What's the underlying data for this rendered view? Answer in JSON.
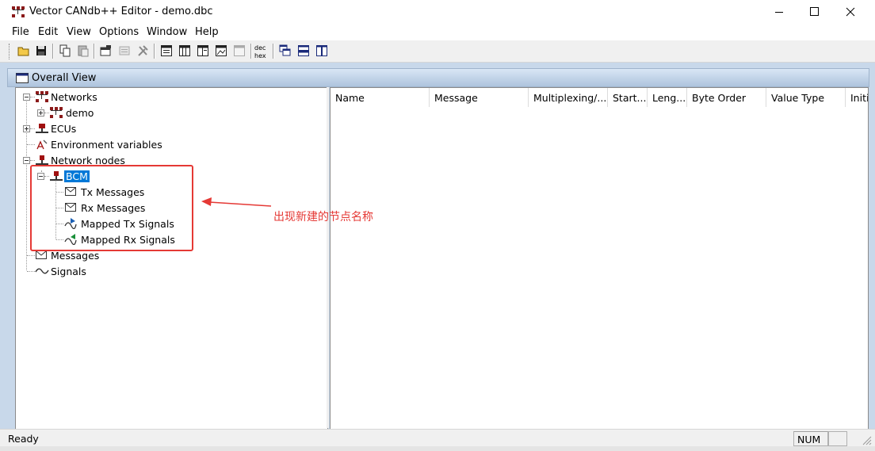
{
  "window": {
    "title": "Vector CANdb++ Editor - demo.dbc",
    "controls": {
      "minimize": "minimize-icon",
      "maximize": "maximize-icon",
      "close": "close-icon"
    }
  },
  "menu": [
    "File",
    "Edit",
    "View",
    "Options",
    "Window",
    "Help"
  ],
  "toolbar": {
    "buttons": [
      "open-folder-icon",
      "save-icon",
      "copy-icon",
      "paste-icon",
      "properties-icon",
      "disabled-icon",
      "tools-icon",
      "list-view-icon",
      "table-view-icon",
      "detail-view-icon",
      "image-view-icon",
      "disabled-view-icon",
      "dec-hex-icon",
      "cascade-icon",
      "tile-horizontal-icon",
      "tile-vertical-icon"
    ],
    "dec_hex_label_top": "dec",
    "dec_hex_label_bottom": "hex"
  },
  "overall_view": {
    "title": "Overall View"
  },
  "tree": {
    "networks": "Networks",
    "demo": "demo",
    "ecus": "ECUs",
    "env_vars": "Environment variables",
    "network_nodes": "Network nodes",
    "bcm": "BCM",
    "tx_messages": "Tx Messages",
    "rx_messages": "Rx Messages",
    "mapped_tx": "Mapped Tx Signals",
    "mapped_rx": "Mapped Rx Signals",
    "messages": "Messages",
    "signals": "Signals"
  },
  "columns": [
    "Name",
    "Message",
    "Multiplexing/...",
    "Start...",
    "Leng...",
    "Byte Order",
    "Value Type",
    "Initi"
  ],
  "annotation": {
    "text": "出现新建的节点名称",
    "color": "#e53935"
  },
  "status": {
    "text": "Ready",
    "num": "NUM"
  },
  "colors": {
    "selection": "#0078d7",
    "annotation_red": "#e53935",
    "mdi_background": "#c8d8ea"
  }
}
